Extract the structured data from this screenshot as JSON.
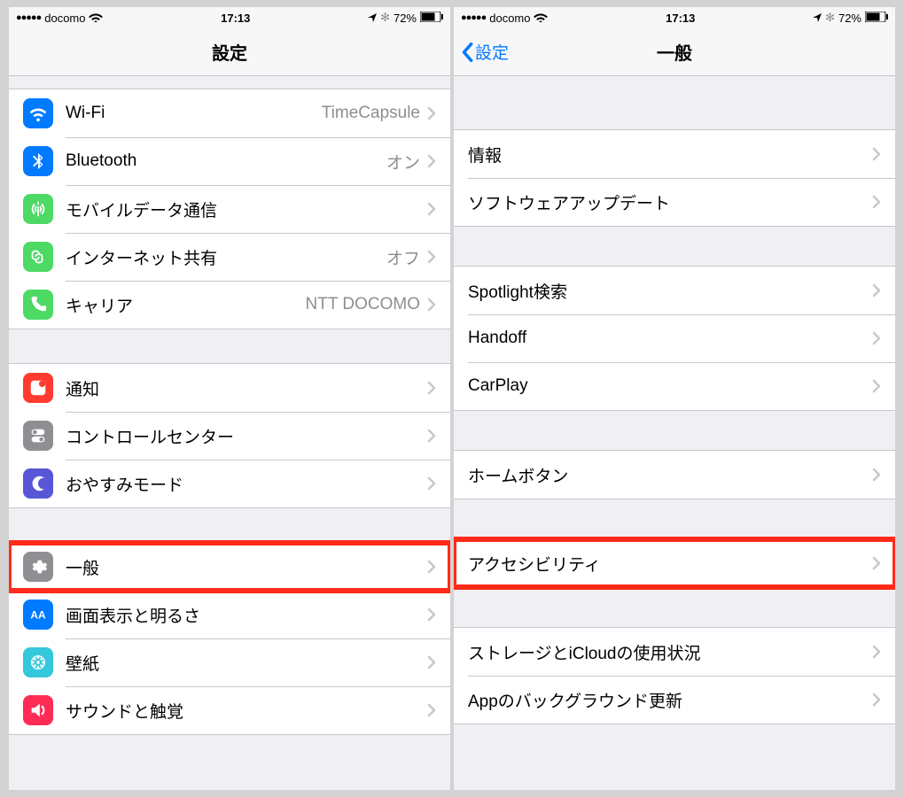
{
  "status": {
    "dots": "●●●●●",
    "carrier": "docomo",
    "time": "17:13",
    "battery": "72%"
  },
  "left": {
    "title": "設定",
    "group1": [
      {
        "label": "Wi-Fi",
        "value": "TimeCapsule",
        "icon": "wifi",
        "bg": "#007aff"
      },
      {
        "label": "Bluetooth",
        "value": "オン",
        "icon": "bluetooth",
        "bg": "#007aff"
      },
      {
        "label": "モバイルデータ通信",
        "value": "",
        "icon": "cellular",
        "bg": "#4cd964"
      },
      {
        "label": "インターネット共有",
        "value": "オフ",
        "icon": "hotspot",
        "bg": "#4cd964"
      },
      {
        "label": "キャリア",
        "value": "NTT DOCOMO",
        "icon": "phone",
        "bg": "#4cd964"
      }
    ],
    "group2": [
      {
        "label": "通知",
        "value": "",
        "icon": "notif",
        "bg": "#ff3b30"
      },
      {
        "label": "コントロールセンター",
        "value": "",
        "icon": "control",
        "bg": "#8e8e93"
      },
      {
        "label": "おやすみモード",
        "value": "",
        "icon": "moon",
        "bg": "#5856d6"
      }
    ],
    "group3": [
      {
        "label": "一般",
        "value": "",
        "icon": "gear",
        "bg": "#8e8e93",
        "highlight": true
      },
      {
        "label": "画面表示と明るさ",
        "value": "",
        "icon": "display",
        "bg": "#007aff"
      },
      {
        "label": "壁紙",
        "value": "",
        "icon": "wallpaper",
        "bg": "#34c8db"
      },
      {
        "label": "サウンドと触覚",
        "value": "",
        "icon": "sound",
        "bg": "#ff2d55"
      }
    ]
  },
  "right": {
    "back": "設定",
    "title": "一般",
    "groups": [
      [
        {
          "label": "情報"
        },
        {
          "label": "ソフトウェアアップデート"
        }
      ],
      [
        {
          "label": "Spotlight検索"
        },
        {
          "label": "Handoff"
        },
        {
          "label": "CarPlay"
        }
      ],
      [
        {
          "label": "ホームボタン"
        }
      ],
      [
        {
          "label": "アクセシビリティ",
          "highlight": true
        }
      ],
      [
        {
          "label": "ストレージとiCloudの使用状況"
        },
        {
          "label": "Appのバックグラウンド更新"
        }
      ]
    ]
  }
}
